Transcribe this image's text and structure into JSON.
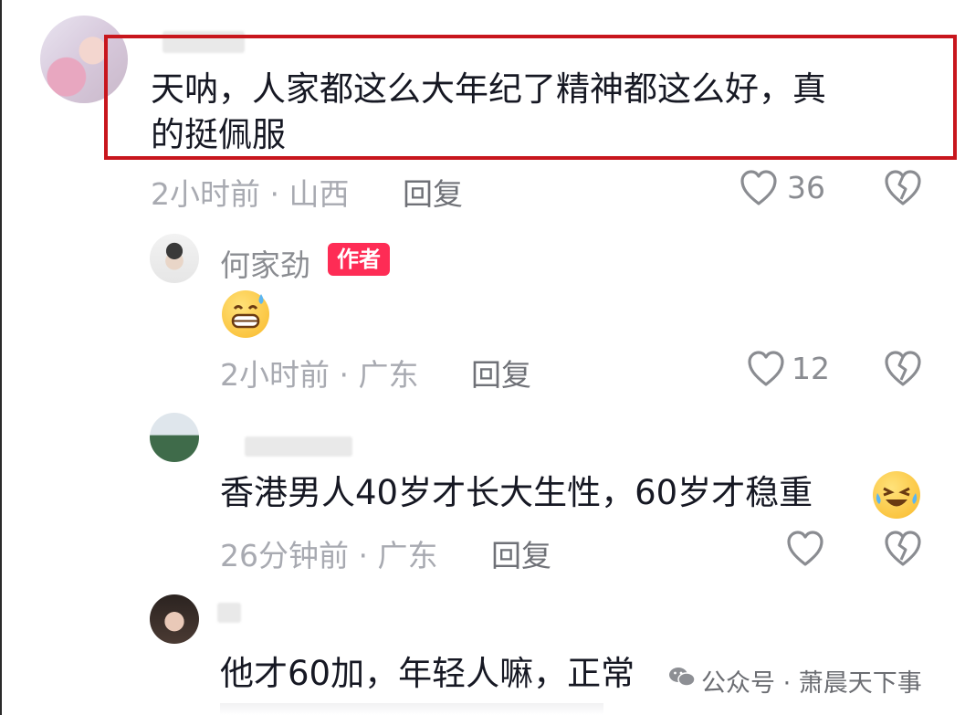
{
  "comments": [
    {
      "text": "天呐，人家都这么大年纪了精神都这么好，真的挺佩服",
      "line1": "天呐，人家都这么大年纪了精神都这么好，真",
      "line2": "的挺佩服",
      "meta": "2小时前 · 山西",
      "reply": "回复",
      "likes": "36"
    },
    {
      "author": "何家劲",
      "badge": "作者",
      "meta": "2小时前 · 广东",
      "reply": "回复",
      "likes": "12"
    },
    {
      "text": "香港男人40岁才长大生性，60岁才稳重",
      "meta": "26分钟前 · 广东",
      "reply": "回复",
      "likes": ""
    },
    {
      "text": "他才60加，年轻人嘛，正常"
    }
  ],
  "watermark": {
    "text": "公众号 · 萧晨天下事",
    "icon": "wechat-icon"
  },
  "colors": {
    "highlight": "#c8161d",
    "badge": "#fe2c55",
    "meta": "#a8aab1"
  }
}
